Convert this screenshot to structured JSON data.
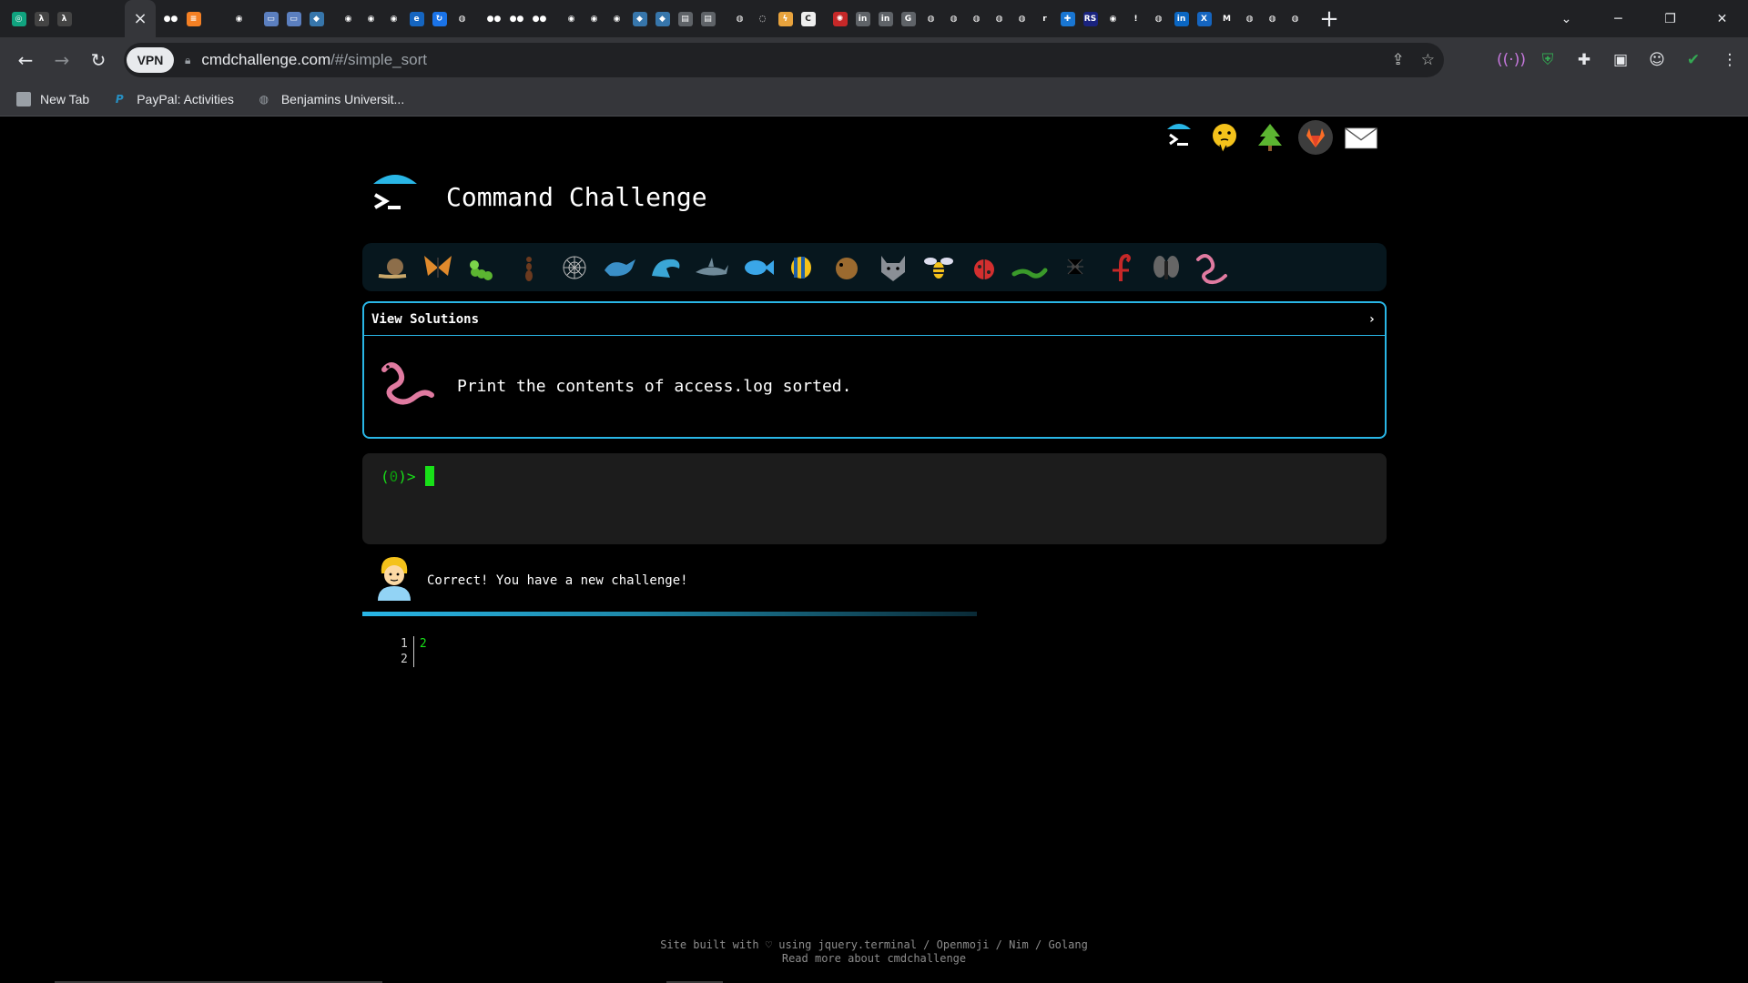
{
  "browser": {
    "tabs": [
      {
        "name": "chatgpt",
        "glyph": "◎",
        "color": "#10a37f"
      },
      {
        "name": "lambda-a",
        "glyph": "λ",
        "color": "#444"
      },
      {
        "name": "lambda-b",
        "glyph": "λ",
        "color": "#444"
      },
      {
        "name": "blank-a",
        "glyph": "",
        "color": "#202124"
      },
      {
        "name": "blank-b",
        "glyph": "",
        "color": "#202124"
      },
      {
        "name": "active",
        "glyph": "×",
        "color": "#35363a",
        "active": true
      },
      {
        "name": "medium-a",
        "glyph": "●●",
        "color": "#202124"
      },
      {
        "name": "stackoverflow",
        "glyph": "≡",
        "color": "#f48024"
      },
      {
        "name": "blank-c",
        "glyph": "",
        "color": "#202124"
      },
      {
        "name": "github-a",
        "glyph": "◉",
        "color": "#202124"
      },
      {
        "name": "gap",
        "glyph": "",
        "color": "#202124"
      },
      {
        "name": "book-a",
        "glyph": "▭",
        "color": "#5b7fbf"
      },
      {
        "name": "book-b",
        "glyph": "▭",
        "color": "#5b7fbf"
      },
      {
        "name": "python-a",
        "glyph": "◆",
        "color": "#3776ab"
      },
      {
        "name": "gap",
        "glyph": "",
        "color": "#202124"
      },
      {
        "name": "github-b",
        "glyph": "◉",
        "color": "#202124"
      },
      {
        "name": "github-c",
        "glyph": "◉",
        "color": "#202124"
      },
      {
        "name": "github-d",
        "glyph": "◉",
        "color": "#202124"
      },
      {
        "name": "e-icon",
        "glyph": "e",
        "color": "#1565c0"
      },
      {
        "name": "refresh-blue",
        "glyph": "↻",
        "color": "#1a73e8"
      },
      {
        "name": "globe-a",
        "glyph": "◍",
        "color": "#202124"
      },
      {
        "name": "gap",
        "glyph": "",
        "color": "#202124"
      },
      {
        "name": "medium-b",
        "glyph": "●●",
        "color": "#202124"
      },
      {
        "name": "medium-c",
        "glyph": "●●",
        "color": "#202124"
      },
      {
        "name": "medium-d",
        "glyph": "●●",
        "color": "#202124"
      },
      {
        "name": "gap",
        "glyph": "",
        "color": "#202124"
      },
      {
        "name": "github-e",
        "glyph": "◉",
        "color": "#202124"
      },
      {
        "name": "github-f",
        "glyph": "◉",
        "color": "#202124"
      },
      {
        "name": "github-g",
        "glyph": "◉",
        "color": "#202124"
      },
      {
        "name": "python-b",
        "glyph": "◆",
        "color": "#3776ab"
      },
      {
        "name": "python-c",
        "glyph": "◆",
        "color": "#3776ab"
      },
      {
        "name": "printer-a",
        "glyph": "▤",
        "color": "#5f6368"
      },
      {
        "name": "printer-b",
        "glyph": "▤",
        "color": "#5f6368"
      },
      {
        "name": "gap",
        "glyph": "",
        "color": "#202124"
      },
      {
        "name": "globe-b",
        "glyph": "◍",
        "color": "#202124"
      },
      {
        "name": "loading-a",
        "glyph": "◌",
        "color": "#202124"
      },
      {
        "name": "bolt",
        "glyph": "ϟ",
        "color": "#e8a33d"
      },
      {
        "name": "c-icon",
        "glyph": "C",
        "color": "#eeeeee"
      },
      {
        "name": "gap",
        "glyph": "",
        "color": "#202124"
      },
      {
        "name": "red-icon",
        "glyph": "✺",
        "color": "#c62828"
      },
      {
        "name": "linkedin-a",
        "glyph": "in",
        "color": "#5f6368"
      },
      {
        "name": "linkedin-b",
        "glyph": "in",
        "color": "#5f6368"
      },
      {
        "name": "g-icon",
        "glyph": "G",
        "color": "#5f6368"
      },
      {
        "name": "globe-c",
        "glyph": "◍",
        "color": "#202124"
      },
      {
        "name": "globe-d",
        "glyph": "◍",
        "color": "#202124"
      },
      {
        "name": "globe-e",
        "glyph": "◍",
        "color": "#202124"
      },
      {
        "name": "globe-f",
        "glyph": "◍",
        "color": "#202124"
      },
      {
        "name": "globe-g",
        "glyph": "◍",
        "color": "#202124"
      },
      {
        "name": "r-icon",
        "glyph": "r",
        "color": "#202124"
      },
      {
        "name": "puzzle",
        "glyph": "✚",
        "color": "#1976d2"
      },
      {
        "name": "rs-icon",
        "glyph": "RS",
        "color": "#1a237e"
      },
      {
        "name": "github-h",
        "glyph": "◉",
        "color": "#202124"
      },
      {
        "name": "exclaim",
        "glyph": "!",
        "color": "#202124"
      },
      {
        "name": "globe-h",
        "glyph": "◍",
        "color": "#202124"
      },
      {
        "name": "linkedin-c",
        "glyph": "in",
        "color": "#0a66c2"
      },
      {
        "name": "x-icon",
        "glyph": "X",
        "color": "#1565c0"
      },
      {
        "name": "gmail",
        "glyph": "M",
        "color": "#202124"
      },
      {
        "name": "globe-i",
        "glyph": "◍",
        "color": "#202124"
      },
      {
        "name": "globe-j",
        "glyph": "◍",
        "color": "#202124"
      },
      {
        "name": "globe-k",
        "glyph": "◍",
        "color": "#202124"
      }
    ],
    "url_host": "cmdchallenge.com",
    "url_path": "/#/simple_sort",
    "vpn_label": "VPN",
    "bookmarks": [
      {
        "label": "New Tab",
        "icon": "page-icon"
      },
      {
        "label": "PayPal: Activities",
        "icon": "paypal-icon"
      },
      {
        "label": "Benjamins Universit...",
        "icon": "globe-icon"
      }
    ]
  },
  "page": {
    "title": "Command Challenge",
    "top_icons": [
      "terminal-icon",
      "thinking-face-icon",
      "tree-icon",
      "gitlab-icon",
      "mail-icon"
    ],
    "critters": [
      "snail",
      "butterfly",
      "caterpillar",
      "ant",
      "web",
      "whale",
      "dolphin",
      "shark",
      "fish",
      "tropical-fish",
      "blowfish",
      "wolf",
      "bee",
      "ladybug",
      "worm-green",
      "spider",
      "scorpion",
      "fly",
      "worm-pink"
    ],
    "challenge": {
      "view_solutions": "View Solutions",
      "description": "Print the contents of access.log sorted."
    },
    "terminal": {
      "prompt_open": "(",
      "prompt_num": "0",
      "prompt_close": ")>"
    },
    "feedback": {
      "text": "Correct! You have a new challenge!",
      "progress_fraction": 0.6
    },
    "output": {
      "line_numbers": [
        "1",
        "2"
      ],
      "lines": [
        "2",
        ""
      ]
    },
    "footer": {
      "line1": "Site built with ♡ using jquery.terminal / Openmoji / Nim / Golang",
      "line2": "Read more about cmdchallenge"
    }
  },
  "colors": {
    "accent": "#29b6e6",
    "terminal_green": "#18e018"
  }
}
